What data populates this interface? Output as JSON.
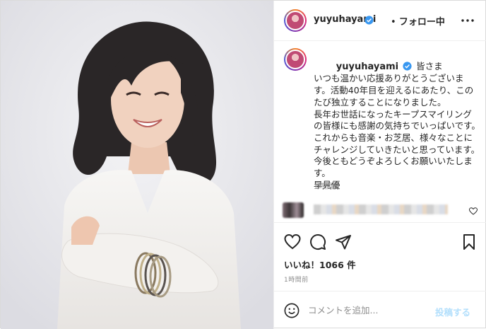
{
  "post": {
    "author": "yuyuhayami",
    "separator": "•",
    "follow_status": "フォロー中",
    "caption": "皆さま\nいつも温かい応援ありがとうございます。活動40年目を迎えるにあたり、このたび独立することになりました。\n長年お世話になったキープスマイリングの皆様にも感謝の気持ちでいっぱいです。これからも音楽・お芝居、様々なことにチャレンジしていきたいと思っています。今後ともどうぞよろしくお願いいたします。\n早見優",
    "caption_time": "1時間前",
    "likes": "いいね！1066 件",
    "post_time": "1時間前"
  },
  "comment": {
    "placeholder": "コメントを追加...",
    "post_label": "投稿する"
  },
  "colors": {
    "verified": "#3897f0",
    "post_button_disabled": "#b2dffc",
    "text": "#262626",
    "muted": "#8e8e8e"
  },
  "icons": {
    "header_more": "more-horizontal-icon",
    "like": "heart-outline-icon",
    "comment": "comment-bubble-icon",
    "share": "paper-plane-icon",
    "save": "bookmark-icon",
    "emoji": "smiley-face-icon",
    "verified": "verified-badge-icon"
  }
}
